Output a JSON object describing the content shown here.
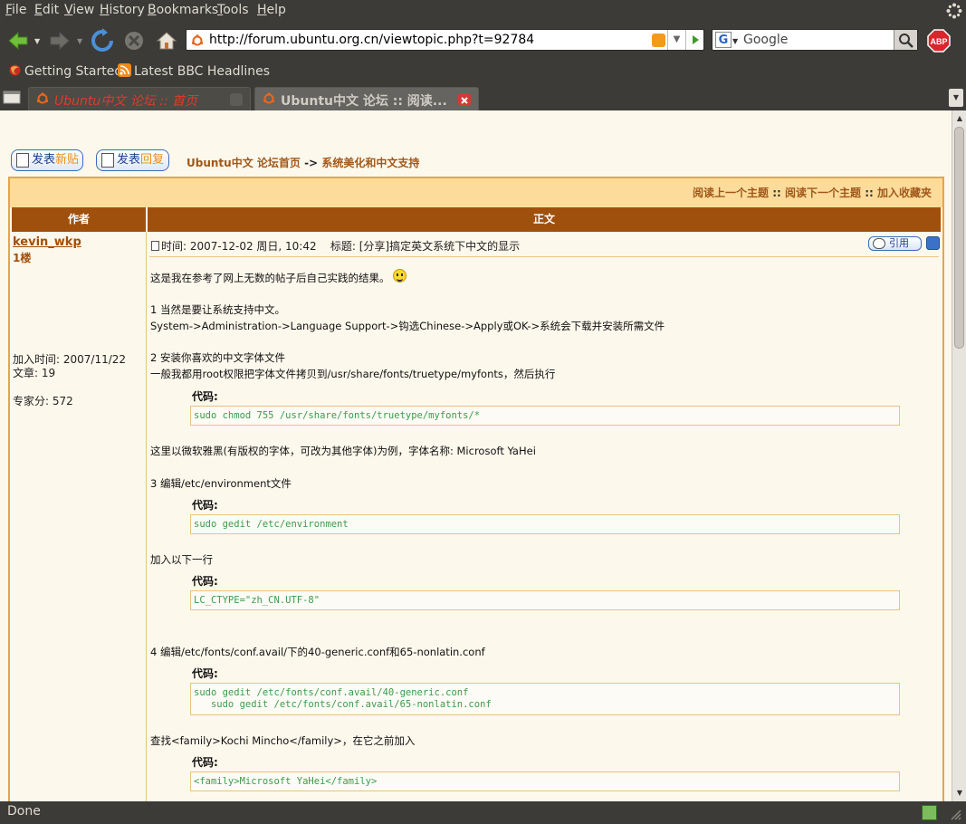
{
  "menubar": {
    "items": [
      {
        "label": "File",
        "key": "F",
        "rest": "ile"
      },
      {
        "label": "Edit",
        "key": "E",
        "rest": "dit"
      },
      {
        "label": "View",
        "key": "V",
        "rest": "iew"
      },
      {
        "label": "History",
        "key": "H",
        "rest": "istory"
      },
      {
        "label": "Bookmarks",
        "key": "B",
        "rest": "ookmarks"
      },
      {
        "label": "Tools",
        "key": "T",
        "rest": "ools"
      },
      {
        "label": "Help",
        "key": "H",
        "rest": "elp"
      }
    ]
  },
  "navbar": {
    "url": "http://forum.ubuntu.org.cn/viewtopic.php?t=92784",
    "search_placeholder": "Google",
    "search_engine_letter": "G",
    "icons": [
      "back-arrow-icon",
      "forward-arrow-icon",
      "reload-icon",
      "stop-icon",
      "home-icon",
      "rss-feed-icon",
      "go-arrow-icon",
      "magnifier-icon",
      "adblock-plus-icon"
    ]
  },
  "bookmarks": {
    "items": [
      "Getting Started",
      "Latest BBC Headlines"
    ]
  },
  "tabs": [
    {
      "label": "Ubuntu中文 论坛 :: 首页",
      "active": false
    },
    {
      "label": "Ubuntu中文 论坛 :: 阅读...",
      "active": true
    }
  ],
  "page": {
    "new_topic_a": "发表",
    "new_topic_b": "新贴",
    "reply_a": "发表",
    "reply_b": "回复",
    "breadcrumb_home": "Ubuntu中文 论坛首页",
    "breadcrumb_sep": "->",
    "breadcrumb_forum": "系统美化和中文支持",
    "topnav_prev": "阅读上一个主题",
    "topnav_next": "阅读下一个主题",
    "topnav_fav": "加入收藏夹",
    "topnav_sep": "::",
    "col_author": "作者",
    "col_body": "正文"
  },
  "post": {
    "author": "kevin_wkp",
    "floor": "1楼",
    "joined": "加入时间: 2007/11/22",
    "posts": "文章: 19",
    "expert": "专家分: 572",
    "time": "时间: 2007-12-02 周日, 10:42",
    "subject": "标题: [分享]搞定英文系统下中文的显示",
    "quote_label": "引用",
    "code_label": "代码:",
    "lines": [
      "这是我在参考了网上无数的帖子后自己实践的结果。",
      "1 当然是要让系统支持中文。",
      "System->Administration->Language Support->钩选Chinese->Apply或OK->系统会下载并安装所需文件",
      "2 安装你喜欢的中文字体文件",
      "一般我都用root权限把字体文件拷贝到/usr/share/fonts/truetype/myfonts，然后执行",
      "这里以微软雅黑(有版权的字体，可改为其他字体)为例，字体名称: Microsoft YaHei",
      "3 编辑/etc/environment文件",
      "加入以下一行",
      "4 编辑/etc/fonts/conf.avail/下的40-generic.conf和65-nonlatin.conf",
      "查找<family>Kochi Mincho</family>，在它之前加入"
    ],
    "codes": [
      "sudo chmod 755 /usr/share/fonts/truetype/myfonts/*",
      "sudo gedit /etc/environment",
      "LC_CTYPE=\"zh_CN.UTF-8\"",
      "sudo gedit /etc/fonts/conf.avail/40-generic.conf\n   sudo gedit /etc/fonts/conf.avail/65-nonlatin.conf",
      "<family>Microsoft YaHei</family>"
    ]
  },
  "status": {
    "text": "Done"
  },
  "colors": {
    "chrome": "#3c3b37",
    "forum_brown": "#a0500d",
    "forum_light": "#fddc9b",
    "code_green": "#3f9a4c"
  }
}
